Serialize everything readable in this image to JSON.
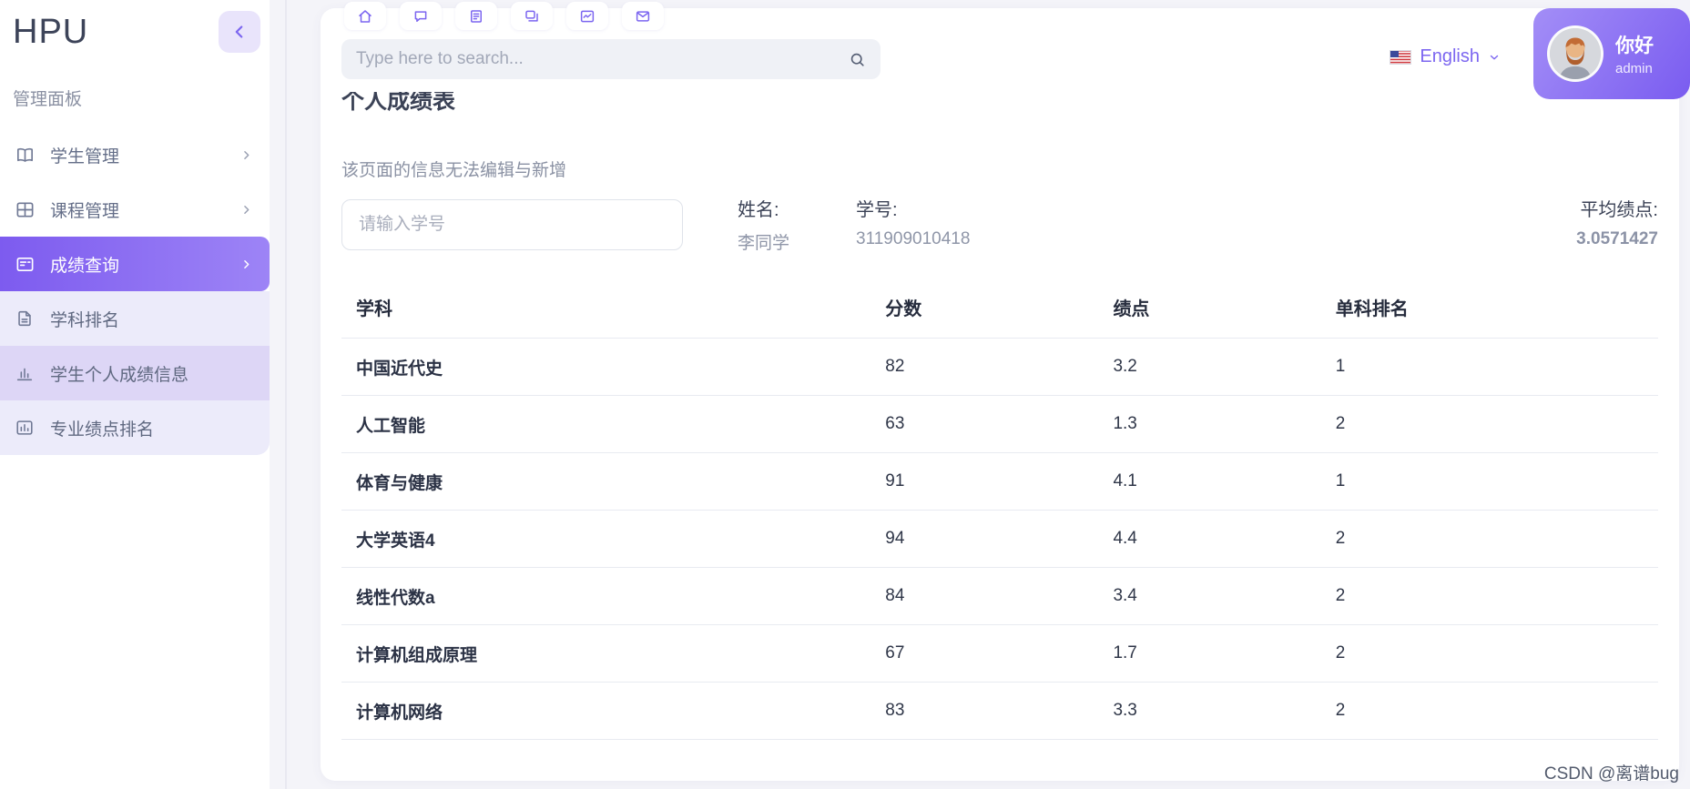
{
  "colors": {
    "accent": "#7c66f0",
    "active_gradient_start": "#7d5bef",
    "active_gradient_end": "#9d84f6",
    "submenu_bg": "#ecebfa",
    "submenu_active_bg": "#ddd6f6",
    "page_bg": "#f4f4f9"
  },
  "sidebar": {
    "logo": "HPU",
    "collapse_icon": "chevron-left-icon",
    "panel_label": "管理面板",
    "items": [
      {
        "label": "学生管理",
        "icon": "book-icon",
        "expandable": true,
        "active": false
      },
      {
        "label": "课程管理",
        "icon": "grid-icon",
        "expandable": true,
        "active": false
      },
      {
        "label": "成绩查询",
        "icon": "grades-card-icon",
        "expandable": true,
        "active": true
      }
    ],
    "subitems": [
      {
        "label": "学科排名",
        "icon": "document-icon",
        "active": false
      },
      {
        "label": "学生个人成绩信息",
        "icon": "bar-chart-icon",
        "active": true
      },
      {
        "label": "专业绩点排名",
        "icon": "chart-box-icon",
        "active": false
      }
    ]
  },
  "header": {
    "quick_icons": [
      "home-icon",
      "chat-bubble-icon",
      "document-lines-icon",
      "forum-icon",
      "chart-window-icon",
      "mail-icon"
    ],
    "search_placeholder": "Type here to search...",
    "search_icon": "search-icon",
    "language": {
      "flag": "us-flag-icon",
      "label": "English",
      "chevron": "chevron-down-icon"
    },
    "user": {
      "greeting": "你好",
      "name": "admin"
    }
  },
  "page": {
    "title": "个人成绩表",
    "note": "该页面的信息无法编辑与新增",
    "student_search_placeholder": "请输入学号",
    "fields": {
      "name_label": "姓名:",
      "name_value": "李同学",
      "student_id_label": "学号:",
      "student_id_value": "311909010418",
      "gpa_label": "平均绩点:",
      "gpa_value": "3.0571427"
    }
  },
  "table": {
    "headers": [
      "学科",
      "分数",
      "绩点",
      "单科排名"
    ],
    "rows": [
      {
        "subject": "中国近代史",
        "score": "82",
        "gpa": "3.2",
        "rank": "1"
      },
      {
        "subject": "人工智能",
        "score": "63",
        "gpa": "1.3",
        "rank": "2"
      },
      {
        "subject": "体育与健康",
        "score": "91",
        "gpa": "4.1",
        "rank": "1"
      },
      {
        "subject": "大学英语4",
        "score": "94",
        "gpa": "4.4",
        "rank": "2"
      },
      {
        "subject": "线性代数a",
        "score": "84",
        "gpa": "3.4",
        "rank": "2"
      },
      {
        "subject": "计算机组成原理",
        "score": "67",
        "gpa": "1.7",
        "rank": "2"
      },
      {
        "subject": "计算机网络",
        "score": "83",
        "gpa": "3.3",
        "rank": "2"
      }
    ]
  },
  "watermark": "CSDN @离谱bug"
}
